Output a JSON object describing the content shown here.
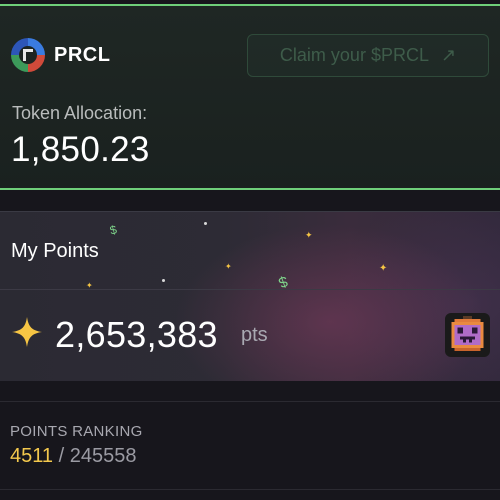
{
  "token": {
    "brand_name": "PRCL",
    "claim_label": "Claim your $PRCL",
    "claim_icon": "arrow-up-right-icon",
    "allocation_label": "Token Allocation:",
    "allocation_value": "1,850.23"
  },
  "points": {
    "title": "My Points",
    "value": "2,653,383",
    "unit": "pts",
    "star_icon": "sparkle-star-icon",
    "avatar_icon": "pixel-pumpkin-avatar"
  },
  "ranking": {
    "label": "POINTS RANKING",
    "rank": "4511",
    "separator": "/",
    "total": "245558"
  },
  "colors": {
    "accent_green": "#6fcf7a",
    "rank_gold": "#f3c84d",
    "star_gold": "#f6c544",
    "background": "#17161c"
  }
}
